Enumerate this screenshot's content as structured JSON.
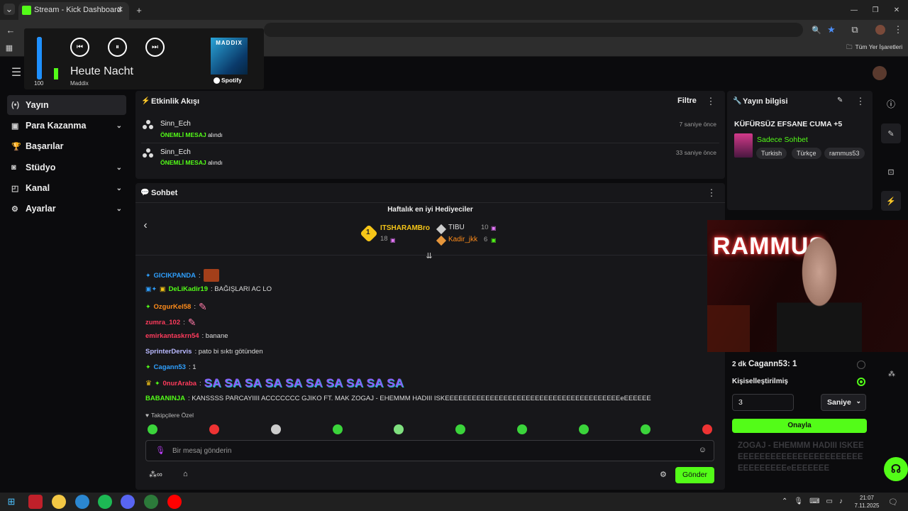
{
  "browser": {
    "tab_title": "Stream - Kick Dashboard",
    "new_tab": "+",
    "bookmarks_label": "Tüm Yer İşaretleri",
    "window_controls": [
      "—",
      "❐",
      "✕"
    ]
  },
  "media": {
    "volume": "100",
    "volume_level": 1.0,
    "track": "Heute Nacht",
    "artist": "Maddix",
    "album_art_text": "MADDIX",
    "source": "Spotify"
  },
  "nav": {
    "items": [
      {
        "label": "Yayın",
        "icon": "(•)",
        "chev": ""
      },
      {
        "label": "Para Kazanma",
        "icon": "▣",
        "chev": "⌄"
      },
      {
        "label": "Başarılar",
        "icon": "🏆",
        "chev": ""
      },
      {
        "label": "Stüdyo",
        "icon": "◙",
        "chev": "⌄"
      },
      {
        "label": "Kanal",
        "icon": "◰",
        "chev": "⌄"
      },
      {
        "label": "Ayarlar",
        "icon": "⚙",
        "chev": "⌄"
      }
    ]
  },
  "activity": {
    "title": "Etkinlik Akışı",
    "filter": "Filtre",
    "items": [
      {
        "user": "Sinn_Ech",
        "highlight": "ÖNEMLİ MESAJ",
        "suffix": "alındı",
        "time": "7 saniye önce"
      },
      {
        "user": "Sinn_Ech",
        "highlight": "ÖNEMLİ MESAJ",
        "suffix": "alındı",
        "time": "33 saniye önce"
      }
    ]
  },
  "chat": {
    "title": "Sohbet",
    "gifters_title": "Haftalık en iyi Hediyeciler",
    "gifters": [
      {
        "rank": "1",
        "name": "ITSHARAMBro",
        "count": "18"
      },
      {
        "rank": "2",
        "name": "TIBU",
        "count": "10"
      },
      {
        "rank": "3",
        "name": "Kadir_jkk",
        "count": "6"
      }
    ],
    "messages": [
      {
        "user": "GICIKPANDA",
        "text": ":",
        "color": "#2fa0ff"
      },
      {
        "user": "DeLiKadir19",
        "text": ": BAĞIŞLARI AC LO",
        "color": "#53fc18"
      },
      {
        "user": "OzgurKel58",
        "text": ":",
        "color": "#ff8c1a"
      },
      {
        "user": "zumra_102",
        "text": ":",
        "color": "#ff3b5c"
      },
      {
        "user": "emirkantaskrn54",
        "text": ": banane",
        "color": "#ff3b5c"
      },
      {
        "user": "SprinterDervis",
        "text": ": pato bi sıktı götünden",
        "color": "#b9b9ff"
      },
      {
        "user": "Cagann53",
        "text": ": 1",
        "color": "#2fa0ff"
      },
      {
        "user": "0nurAraba",
        "text": ":",
        "color": "#ff3b5c"
      },
      {
        "user": "BABANINJA",
        "text": ": KANSSSS PARCAYIIII ACCCCCCC GJIKO FT. MAK ZOGAJ - EHEMMM HADIII ISKEEEEEEEEEEEEEEEEEEEEEEEEEEEEEEEEEEEEEEEeEEEEEE",
        "color": "#53fc18"
      }
    ],
    "sasa_text": "SA SA SA SA SA SA SA SA SA SA",
    "followers_only": "Takipçilere Özel",
    "input_placeholder": "Bir mesaj gönderin",
    "send": "Gönder"
  },
  "stream_info": {
    "title": "Yayın bilgisi",
    "stream_title": "KÜFÜRSÜZ EFSANE CUMA +5",
    "category": "Sadece Sohbet",
    "tags": [
      "Turkish",
      "Türkçe",
      "rammus53"
    ]
  },
  "side_overlay": {
    "count_label": "2 dk",
    "user_line": "Cagann53: 1",
    "custom_label": "Kişiselleştirilmiş",
    "value": "3",
    "unit": "Saniye",
    "confirm": "Onayla",
    "ghost_text": "ZOGAJ - EHEMMM HADIII ISKEEEEEEEEEEEEEEEEEEEEEEEEEEEEEEEEEEeEEEEEEE"
  },
  "webcam": {
    "banner": "RAMMUS"
  },
  "taskbar": {
    "time": "21:07",
    "date": "7.11.2025"
  }
}
